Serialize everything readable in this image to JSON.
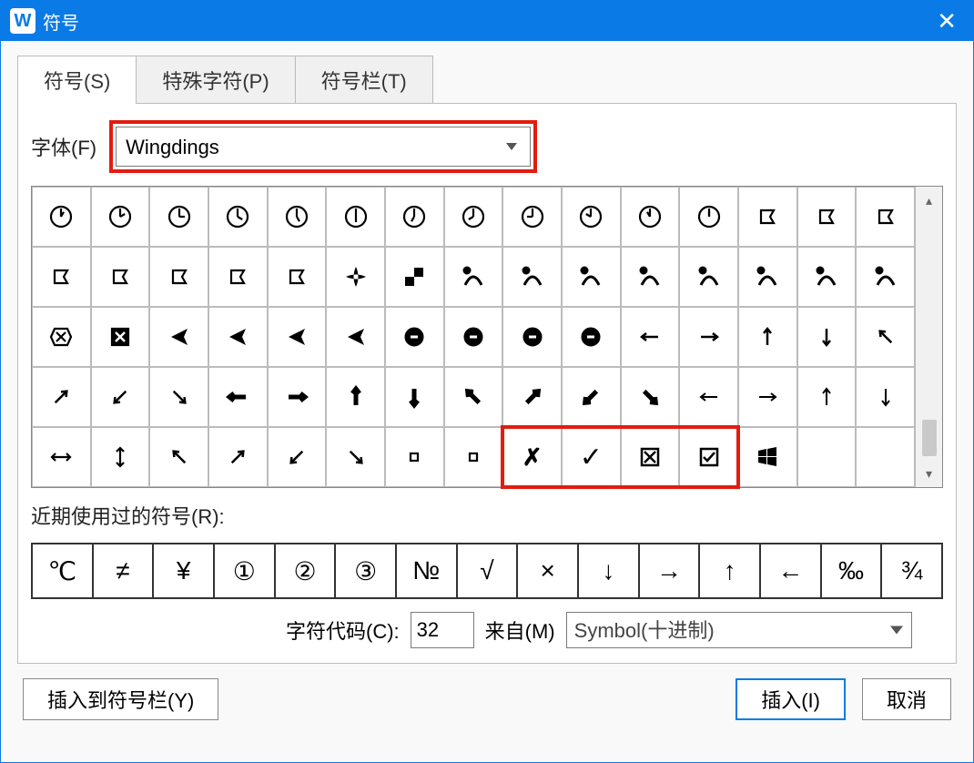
{
  "title": "符号",
  "tabs": [
    {
      "id": "symbols",
      "label": "符号(S)",
      "active": true
    },
    {
      "id": "special",
      "label": "特殊字符(P)",
      "active": false
    },
    {
      "id": "bar",
      "label": "符号栏(T)",
      "active": false
    }
  ],
  "font_label": "字体(F)",
  "font_value": "Wingdings",
  "grid": {
    "rows": [
      [
        "clock-1",
        "clock-2",
        "clock-3",
        "clock-4",
        "clock-5",
        "clock-6",
        "clock-7",
        "clock-8",
        "clock-9",
        "clock-10",
        "clock-11",
        "clock-12",
        "ribbon-right",
        "ribbon-left",
        "ribbon-back"
      ],
      [
        "ribbon-up",
        "ribbon-down",
        "ribbon-ne",
        "ribbon-nw",
        "ribbon-se",
        "cross-petals",
        "checker",
        "leaf-1",
        "leaf-2",
        "leaf-3",
        "leaf-4",
        "leaf-5",
        "leaf-6",
        "leaf-7",
        "leaf-8"
      ],
      [
        "box-x-outline",
        "box-x-fill",
        "cursor-left",
        "cursor-right",
        "cursor-up",
        "cursor-down",
        "circle-arrow-1",
        "circle-arrow-2",
        "circle-arrow-3",
        "circle-arrow-4",
        "arrow-left",
        "arrow-right",
        "arrow-up",
        "arrow-down",
        "arrow-nw"
      ],
      [
        "arrow-ne",
        "arrow-sw",
        "arrow-se",
        "bold-left",
        "bold-right",
        "bold-up",
        "bold-down",
        "bold-nw",
        "bold-ne",
        "bold-sw",
        "bold-se",
        "outline-left",
        "outline-right",
        "outline-up",
        "outline-down"
      ],
      [
        "outline-lr",
        "outline-ud",
        "sm-arrow-nw",
        "sm-arrow-ne",
        "sm-arrow-sw",
        "sm-arrow-se",
        "small-square-1",
        "small-square-2",
        "x-mark",
        "check-mark",
        "box-x",
        "box-check",
        "windows-logo",
        "",
        ""
      ]
    ],
    "highlight": {
      "row": 4,
      "cols": [
        8,
        11
      ]
    }
  },
  "recent_label": "近期使用过的符号(R):",
  "recent": [
    "℃",
    "≠",
    "¥",
    "①",
    "②",
    "③",
    "№",
    "√",
    "×",
    "↓",
    "→",
    "↑",
    "←",
    "‰",
    "¾"
  ],
  "char_code_label": "字符代码(C):",
  "char_code_value": "32",
  "from_label": "来自(M)",
  "from_value": "Symbol(十进制)",
  "buttons": {
    "insert_to_bar": "插入到符号栏(Y)",
    "insert": "插入(I)",
    "cancel": "取消"
  }
}
